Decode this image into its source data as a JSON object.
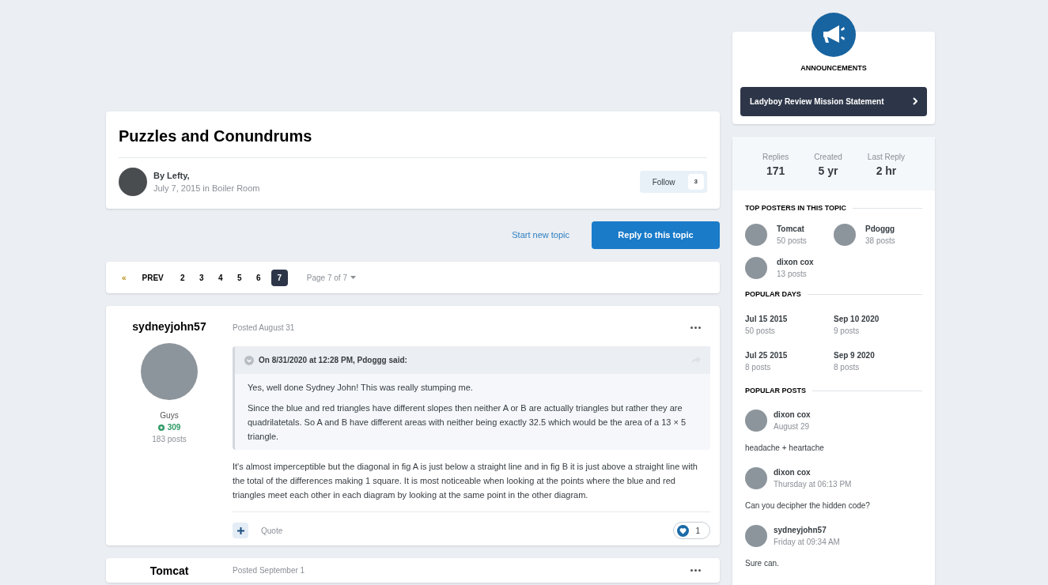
{
  "topic": {
    "title": "Puzzles and Conundrums",
    "author": "By Lefty,",
    "meta": "July 7, 2015 in Boiler Room",
    "follow_label": "Follow",
    "follow_count": "3"
  },
  "actions": {
    "start_topic": "Start new topic",
    "reply": "Reply to this topic"
  },
  "pagination": {
    "first": "«",
    "prev": "PREV",
    "pages": [
      {
        "label": "2",
        "selected": false
      },
      {
        "label": "3",
        "selected": false
      },
      {
        "label": "4",
        "selected": false
      },
      {
        "label": "5",
        "selected": false
      },
      {
        "label": "6",
        "selected": false
      },
      {
        "label": "7",
        "selected": true
      }
    ],
    "page_menu": "Page 7 of 7"
  },
  "posts": [
    {
      "author": "sydneyjohn57",
      "posted": "Posted August 31",
      "group": "Guys",
      "reputation": "309",
      "post_count": "183 posts",
      "quote": {
        "header": "On 8/31/2020 at 12:28 PM, Pdoggg said:",
        "paragraphs": [
          "Yes, well done Sydney John!  This was really stumping me.",
          "Since the blue and red triangles have different slopes then neither A or B are actually triangles but rather they are quadrilatetals. So A and B have different areas with neither being exactly 32.5 which would be the area of a 13 × 5 triangle."
        ]
      },
      "body": "It's almost imperceptible but the diagonal in fig A is just below a straight line and in fig B it is just above a straight line with the total of the differences making 1 square. It is most noticeable when looking at the points where the blue and red triangles meet each other in each diagram by looking at the same point in the other diagram.",
      "quote_label": "Quote",
      "likes": "1"
    },
    {
      "author": "Tomcat",
      "posted": "Posted September 1"
    }
  ],
  "sidebar": {
    "announcements": {
      "heading": "ANNOUNCEMENTS",
      "item": "Ladyboy Review Mission Statement"
    },
    "stats": [
      {
        "label": "Replies",
        "value": "171"
      },
      {
        "label": "Created",
        "value": "5 yr"
      },
      {
        "label": "Last Reply",
        "value": "2 hr"
      }
    ],
    "top_posters": {
      "heading": "TOP POSTERS IN THIS TOPIC",
      "items": [
        {
          "name": "Tomcat",
          "posts": "50 posts"
        },
        {
          "name": "Pdoggg",
          "posts": "38 posts"
        },
        {
          "name": "dixon cox",
          "posts": "13 posts"
        }
      ]
    },
    "popular_days": {
      "heading": "POPULAR DAYS",
      "items": [
        {
          "date": "Jul 15 2015",
          "posts": "50 posts"
        },
        {
          "date": "Sep 10 2020",
          "posts": "9 posts"
        },
        {
          "date": "Jul 25 2015",
          "posts": "8 posts"
        },
        {
          "date": "Sep 9 2020",
          "posts": "8 posts"
        }
      ]
    },
    "popular_posts": {
      "heading": "POPULAR POSTS",
      "items": [
        {
          "name": "dixon cox",
          "time": "August 29",
          "excerpt": "headache + heartache"
        },
        {
          "name": "dixon cox",
          "time": "Thursday at 06:13 PM",
          "excerpt": "Can you decipher the hidden code?"
        },
        {
          "name": "sydneyjohn57",
          "time": "Friday at 09:34 AM",
          "excerpt": "Sure can."
        }
      ]
    }
  }
}
